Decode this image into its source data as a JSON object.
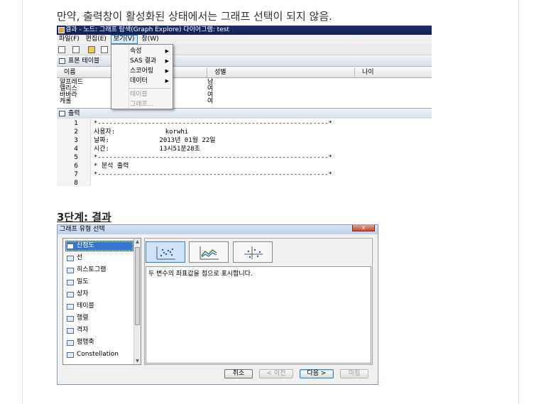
{
  "intro": {
    "text": "만약, 출력창이 활성화된 상태에서는 그래프 선택이 되지 않음."
  },
  "screenshot1": {
    "window_title": "결과 - 노드: 그래프 탐색(Graph Explore)  다이어그램: test",
    "menubar": [
      "파일(F)",
      "편집(E)",
      "보기(V)",
      "창(W)"
    ],
    "view_menu": [
      {
        "label": "속성",
        "submenu": true,
        "enabled": true
      },
      {
        "label": "SAS 결과",
        "submenu": true,
        "enabled": true
      },
      {
        "label": "스코어링",
        "submenu": true,
        "enabled": true
      },
      {
        "label": "데이터",
        "submenu": true,
        "enabled": true
      },
      {
        "label": "테이블",
        "submenu": false,
        "enabled": false
      },
      {
        "label": "그래프...",
        "submenu": false,
        "enabled": false
      }
    ],
    "sample_panel_title": "표본 테이블",
    "table_columns": [
      "이름",
      "성별",
      "나이"
    ],
    "table_rows": [
      [
        "알프레드",
        "남",
        ""
      ],
      [
        "앨리스",
        "여",
        ""
      ],
      [
        "바바라",
        "여",
        ""
      ],
      [
        "캐롤",
        "여",
        ""
      ]
    ],
    "output_panel_title": "출력",
    "line_numbers": [
      "1",
      "2",
      "3",
      "4",
      "5",
      "6",
      "7",
      "8"
    ],
    "output_lines": [
      "*------------------------------------------------------------*",
      "사용자:             korwhi",
      "날짜:             2013년 01월 22일",
      "시간:             13시51분28초",
      "*------------------------------------------------------------*",
      "* 분석 출력",
      "*------------------------------------------------------------*",
      ""
    ]
  },
  "step3": {
    "heading": "3단계: 결과"
  },
  "screenshot2": {
    "dialog_title": "그래프 유형 선택",
    "close_label": "x",
    "graph_types": [
      {
        "label": "산점도",
        "icon": "scatter-icon",
        "selected": true
      },
      {
        "label": "선",
        "icon": "line-chart-icon",
        "selected": false
      },
      {
        "label": "히스토그램",
        "icon": "histogram-icon",
        "selected": false
      },
      {
        "label": "밀도",
        "icon": "density-icon",
        "selected": false
      },
      {
        "label": "상자",
        "icon": "box-plot-icon",
        "selected": false
      },
      {
        "label": "테이블",
        "icon": "table-icon",
        "selected": false
      },
      {
        "label": "행렬",
        "icon": "matrix-icon",
        "selected": false
      },
      {
        "label": "격자",
        "icon": "lattice-icon",
        "selected": false
      },
      {
        "label": "평행축",
        "icon": "parallel-axis-icon",
        "selected": false
      },
      {
        "label": "Constellation",
        "icon": "constellation-icon",
        "selected": false
      }
    ],
    "thumbnails": [
      {
        "icon": "scatter-thumbnail-icon",
        "selected": true
      },
      {
        "icon": "line-scatter-thumbnail-icon",
        "selected": false
      },
      {
        "icon": "axis-scatter-thumbnail-icon",
        "selected": false
      }
    ],
    "description": "두 변수의 좌표값을 점으로 표시합니다.",
    "buttons": [
      {
        "label": "취소",
        "enabled": true
      },
      {
        "label": "< 이전",
        "enabled": false
      },
      {
        "label": "다음 >",
        "enabled": true
      },
      {
        "label": "마침",
        "enabled": false
      }
    ]
  }
}
